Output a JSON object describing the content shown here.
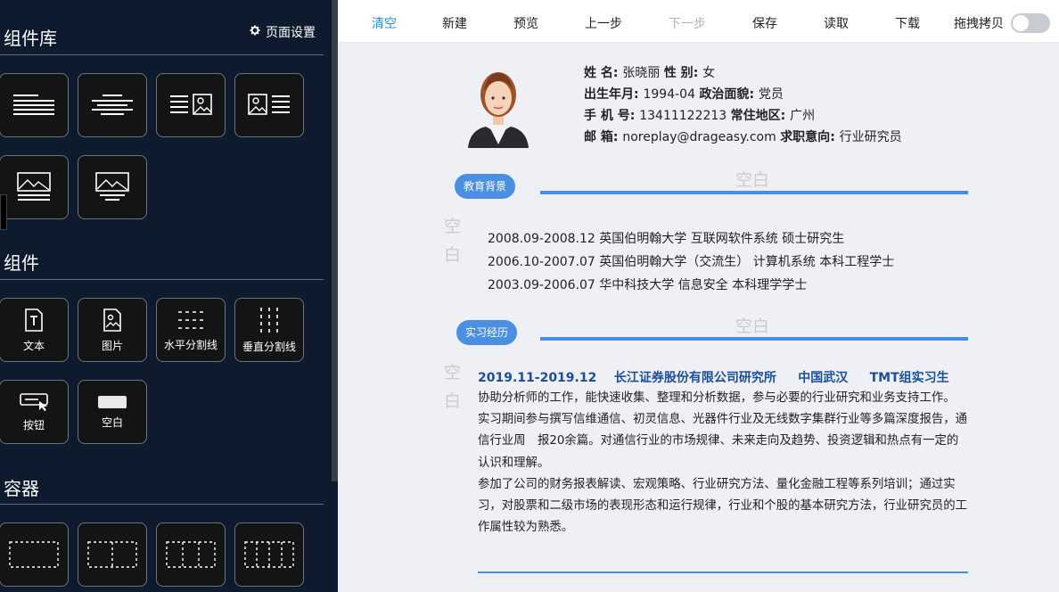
{
  "sidebar": {
    "library_title": "组件库",
    "page_settings": "页面设置",
    "components_title": "组件",
    "containers_title": "容器",
    "component_tiles": [
      {
        "label": "文本",
        "icon": "text-icon"
      },
      {
        "label": "图片",
        "icon": "image-icon"
      },
      {
        "label": "水平分割线",
        "icon": "horizontal-divider-icon"
      },
      {
        "label": "垂直分割线",
        "icon": "vertical-divider-icon"
      },
      {
        "label": "按钮",
        "icon": "button-icon"
      },
      {
        "label": "空白",
        "icon": "blank-icon"
      }
    ]
  },
  "toolbar": {
    "clear": "清空",
    "new": "新建",
    "preview": "预览",
    "prev_step": "上一步",
    "next_step": "下一步",
    "save": "保存",
    "read": "读取",
    "download": "下载",
    "drag_copy": "拖拽拷贝",
    "active_color": "#2b8fd6",
    "disabled_color": "#b0b4ba",
    "drag_copy_enabled": false
  },
  "resume": {
    "name_label": "姓 名",
    "name": "张晓丽",
    "gender_label": "性 别",
    "gender": "女",
    "birth_label": "出生年月",
    "birth": "1994-04",
    "politics_label": "政治面貌",
    "politics": "党员",
    "phone_label": "手 机 号",
    "phone": "13411122213",
    "residence_label": "常住地区",
    "residence": "广州",
    "email_label": "邮 箱",
    "email": "noreplay@drageasy.com",
    "intent_label": "求职意向",
    "intent": "行业研究员",
    "blank_text": "空白",
    "blank_char_1": "空",
    "blank_char_2": "白",
    "education_badge": "教育背景",
    "education": [
      "2008.09-2008.12 英国伯明翰大学 互联网软件系统 硕士研究生",
      "2006.10-2007.07 英国伯明翰大学（交流生） 计算机系统 本科工程学士",
      "2003.09-2006.07 华中科技大学 信息安全 本科理学学士"
    ],
    "internship_badge": "实习经历",
    "internship": {
      "period": "2019.11-2019.12",
      "company": "长江证券股份有限公司研究所",
      "location": "中国武汉",
      "role": "TMT组实习生",
      "paragraphs": [
        "协助分析师的工作，能快速收集、整理和分析数据，参与必要的行业研究和业务支持工作。",
        "实习期间参与撰写信维通信、初灵信息、光器件行业及无线数字集群行业等多篇深度报告，通信行业周　报20余篇。对通信行业的市场规律、未来走向及趋势、投资逻辑和热点有一定的认识和理解。",
        "参加了公司的财务报表解读、宏观策略、行业研究方法、量化金融工程等系列培训；通过实习，对股票和二级市场的表现形态和运行规律，行业和个股的基本研究方法，行业研究员的工作属性较为熟悉。"
      ]
    },
    "accent_color": "#4a8fe2"
  }
}
